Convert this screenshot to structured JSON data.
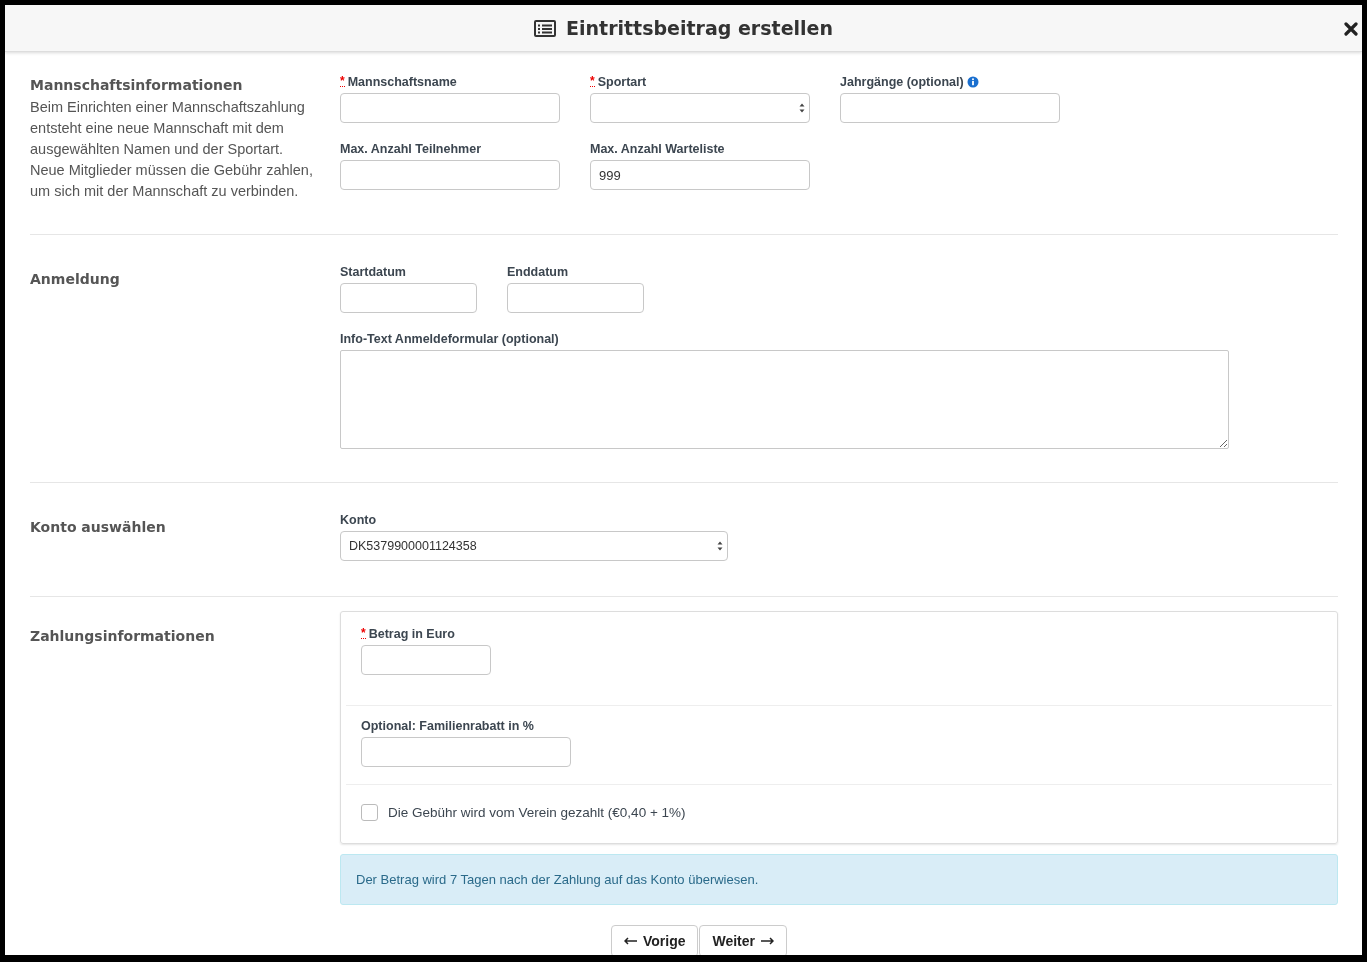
{
  "dialog": {
    "title": "Eintrittsbeitrag erstellen"
  },
  "sections": [
    {
      "kind": "fields",
      "title": "Mannschaftsinformationen",
      "description": "Beim Einrichten einer Mannschaftszahlung entsteht eine neue Mannschaft mit dem ausgewählten Namen und der Sportart. Neue Mitglieder müssen die Gebühr zahlen, um sich mit der Mannschaft zu verbinden.",
      "rows": [
        [
          {
            "label": "Mannschaftsname",
            "required_mark": "*",
            "kind": "text"
          },
          {
            "label": "Sportart",
            "required_mark": "*",
            "kind": "select"
          },
          {
            "label": "Jahrgänge (optional)",
            "kind": "text",
            "info": true
          }
        ],
        [
          {
            "label": "Max. Anzahl Teilnehmer",
            "kind": "text"
          },
          {
            "label": "Max. Anzahl Warteliste",
            "kind": "text",
            "value": "999"
          }
        ]
      ]
    },
    {
      "kind": "registration",
      "title": "Anmeldung",
      "rows": [
        [
          {
            "label": "Startdatum",
            "kind": "date"
          },
          {
            "label": "Enddatum",
            "kind": "date"
          }
        ],
        [
          {
            "label": "Info-Text Anmeldeformular (optional)",
            "kind": "textarea"
          }
        ]
      ]
    },
    {
      "kind": "account",
      "title": "Konto auswählen",
      "rows": [
        [
          {
            "label": "Konto",
            "kind": "wideselect",
            "value": "DK5379900001124358"
          }
        ]
      ]
    },
    {
      "kind": "payment",
      "title": "Zahlungsinformationen",
      "rows": [
        [
          {
            "label": "Betrag in Euro",
            "required_mark": "*",
            "kind": "amount"
          }
        ],
        [
          {
            "label": "Optional: Familienrabatt in %",
            "kind": "percent"
          }
        ]
      ],
      "checkbox": {
        "label": "Die Gebühr wird vom Verein gezahlt (€0,40 + 1%)",
        "checked": false
      },
      "alert": "Der Betrag wird 7 Tagen nach der Zahlung auf das Konto überwiesen."
    }
  ],
  "buttons": [
    {
      "label": "Vorige",
      "kind": "back"
    },
    {
      "label": "Weiter",
      "kind": "next"
    }
  ]
}
